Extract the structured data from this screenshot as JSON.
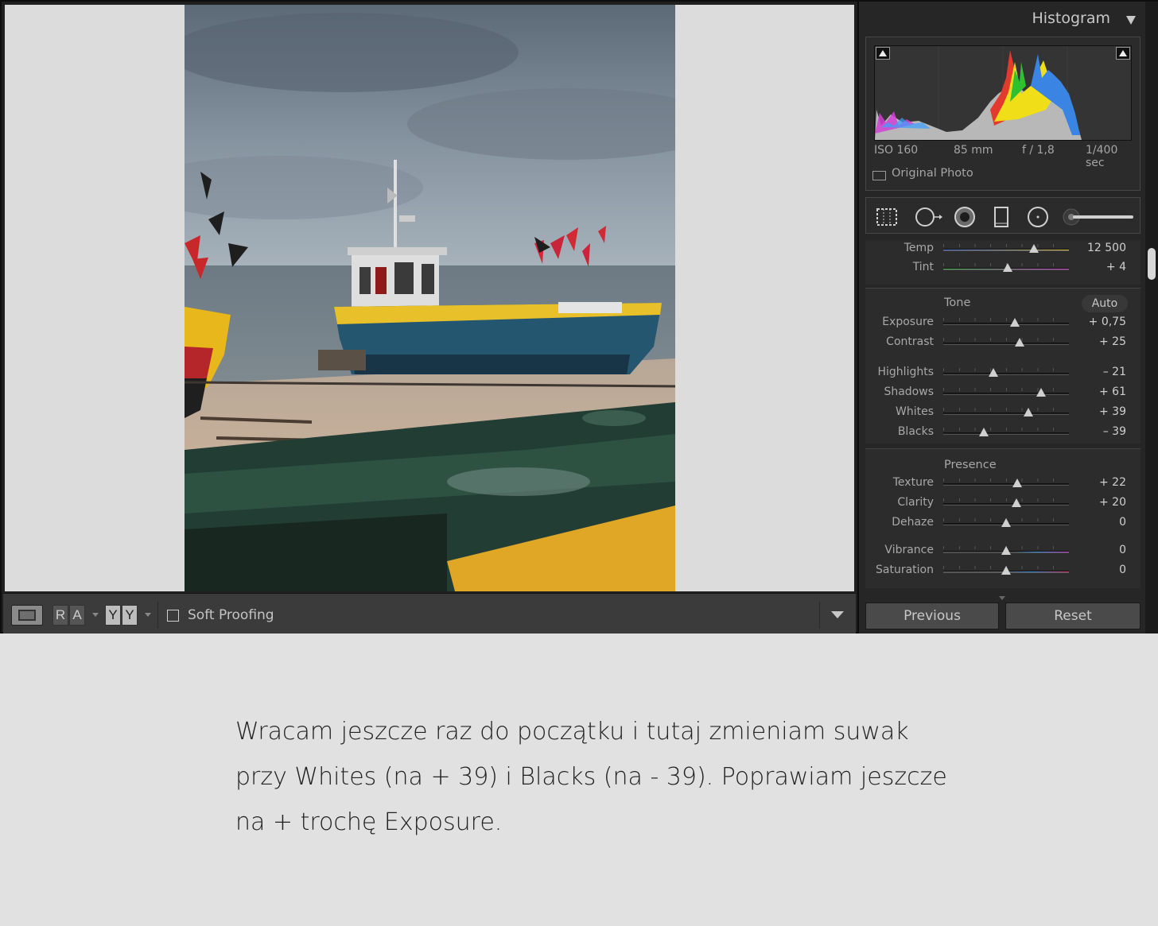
{
  "toolbar": {
    "view_mode_icon": "loupe-view-icon",
    "compare_left_a": "R",
    "compare_left_b": "A",
    "compare_right_a": "Y",
    "compare_right_b": "Y",
    "soft_proofing_label": "Soft Proofing",
    "soft_proofing_checked": false
  },
  "histogram": {
    "title": "Histogram",
    "iso": "ISO 160",
    "focal_length": "85 mm",
    "aperture": "f / 1,8",
    "shutter": "1/400 sec",
    "original_photo_label": "Original Photo"
  },
  "tool_icons": [
    "crop-overlay-icon",
    "spot-removal-icon",
    "red-eye-icon",
    "graduated-filter-icon",
    "radial-filter-icon",
    "adjustment-brush-icon"
  ],
  "white_balance": {
    "rows": [
      {
        "label": "Temp",
        "value": "12 500",
        "position": 0.72
      },
      {
        "label": "Tint",
        "value": "+ 4",
        "position": 0.51
      }
    ]
  },
  "tone": {
    "title": "Tone",
    "auto_label": "Auto",
    "rows": [
      {
        "label": "Exposure",
        "value": "+ 0,75",
        "position": 0.57
      },
      {
        "label": "Contrast",
        "value": "+ 25",
        "position": 0.61
      },
      {
        "label": "Highlights",
        "value": "– 21",
        "position": 0.4
      },
      {
        "label": "Shadows",
        "value": "+ 61",
        "position": 0.78
      },
      {
        "label": "Whites",
        "value": "+ 39",
        "position": 0.68
      },
      {
        "label": "Blacks",
        "value": "– 39",
        "position": 0.32
      }
    ]
  },
  "presence": {
    "title": "Presence",
    "rows": [
      {
        "label": "Texture",
        "value": "+ 22",
        "position": 0.59
      },
      {
        "label": "Clarity",
        "value": "+ 20",
        "position": 0.58
      },
      {
        "label": "Dehaze",
        "value": "0",
        "position": 0.5
      },
      {
        "label": "Vibrance",
        "value": "0",
        "position": 0.5
      },
      {
        "label": "Saturation",
        "value": "0",
        "position": 0.5
      }
    ]
  },
  "buttons": {
    "previous": "Previous",
    "reset": "Reset"
  },
  "caption": {
    "line1": "Wracam jeszcze raz do początku i tutaj zmieniam suwak",
    "line2": "przy Whites (na + 39) i Blacks (na - 39). Poprawiam jeszcze",
    "line3": "na + trochę Exposure."
  }
}
